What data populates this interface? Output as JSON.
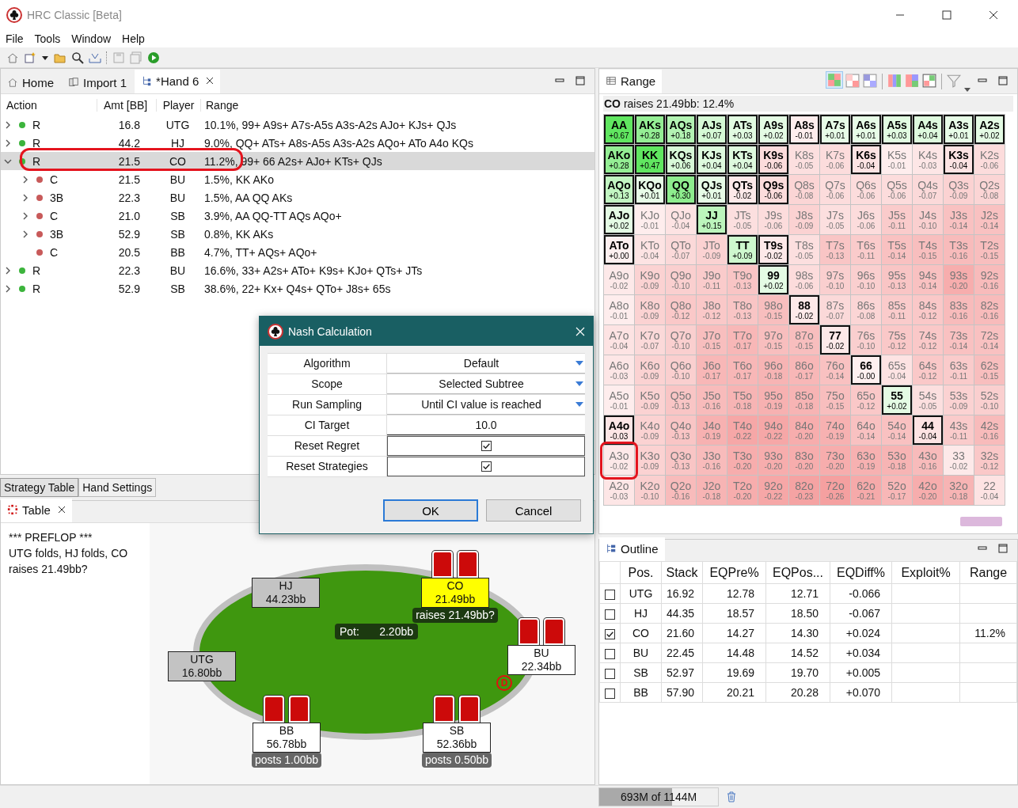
{
  "window": {
    "title": "HRC Classic [Beta]"
  },
  "menu": [
    "File",
    "Tools",
    "Window",
    "Help"
  ],
  "editor_tabs": [
    {
      "label": "Home",
      "kind": "home",
      "selected": false
    },
    {
      "label": "Import 1",
      "kind": "import",
      "selected": false
    },
    {
      "label": "*Hand 6",
      "kind": "tree",
      "selected": true
    }
  ],
  "tree": {
    "columns": [
      "Action",
      "Amt [BB]",
      "Player",
      "Range"
    ],
    "rows": [
      {
        "action": "R",
        "amt": "16.8",
        "player": "UTG",
        "range": "10.1%, 99+ A9s+ A7s-A5s A3s-A2s AJo+ KJs+ QJs",
        "color": "#3cb43c",
        "expandable": true,
        "expanded": false,
        "selected": false,
        "circled": false
      },
      {
        "action": "R",
        "amt": "44.2",
        "player": "HJ",
        "range": "9.0%, QQ+ ATs+ A8s-A5s A3s-A2s AQo+ ATo A4o KQs",
        "color": "#3cb43c",
        "expandable": true,
        "expanded": false,
        "selected": false,
        "circled": false
      },
      {
        "action": "R",
        "amt": "21.5",
        "player": "CO",
        "range": "11.2%, 99+ 66 A2s+ AJo+ KTs+ QJs",
        "color": "#3cb43c",
        "expandable": true,
        "expanded": true,
        "selected": true,
        "circled": true,
        "children": [
          {
            "action": "C",
            "amt": "21.5",
            "player": "BU",
            "range": "1.5%, KK AKo",
            "color": "#c85a5a",
            "expandable": true,
            "expanded": false,
            "selected": false,
            "circled": false
          },
          {
            "action": "3B",
            "amt": "22.3",
            "player": "BU",
            "range": "1.5%, AA QQ AKs",
            "color": "#c85a5a",
            "expandable": true,
            "expanded": false,
            "selected": false,
            "circled": false
          },
          {
            "action": "C",
            "amt": "21.0",
            "player": "SB",
            "range": "3.9%, AA QQ-TT AQs AQo+",
            "color": "#c85a5a",
            "expandable": true,
            "expanded": false,
            "selected": false,
            "circled": false
          },
          {
            "action": "3B",
            "amt": "52.9",
            "player": "SB",
            "range": "0.8%, KK AKs",
            "color": "#c85a5a",
            "expandable": true,
            "expanded": false,
            "selected": false,
            "circled": false
          },
          {
            "action": "C",
            "amt": "20.5",
            "player": "BB",
            "range": "4.7%, TT+ AQs+ AQo+",
            "color": "#c85a5a",
            "expandable": false,
            "selected": false,
            "circled": false
          }
        ]
      },
      {
        "action": "R",
        "amt": "22.3",
        "player": "BU",
        "range": "16.6%, 33+ A2s+ ATo+ K9s+ KJo+ QTs+ JTs",
        "color": "#3cb43c",
        "expandable": true,
        "expanded": false,
        "selected": false,
        "circled": false
      },
      {
        "action": "R",
        "amt": "52.9",
        "player": "SB",
        "range": "38.6%, 22+ Kx+ Q4s+ QTo+ J8s+ 65s",
        "color": "#3cb43c",
        "expandable": true,
        "expanded": false,
        "selected": false,
        "circled": false
      }
    ]
  },
  "bottom_tabs": [
    {
      "label": "Strategy Table",
      "selected": true
    },
    {
      "label": "Hand Settings",
      "selected": false
    }
  ],
  "table_view": {
    "tab": "Table",
    "history": [
      "*** PREFLOP ***",
      "UTG folds, HJ folds, CO raises 21.49bb?"
    ],
    "pot": {
      "label": "Pot:",
      "amount": "2.20bb"
    },
    "dealer": "D",
    "seats": [
      {
        "position": "HJ",
        "stack": "44.23bb",
        "folded": true,
        "acting": false,
        "has_cards": false,
        "dealer": false
      },
      {
        "position": "CO",
        "stack": "21.49bb",
        "folded": false,
        "acting": true,
        "has_cards": true,
        "action": "raises 21.49bb?",
        "pending": true,
        "dealer": false
      },
      {
        "position": "BU",
        "stack": "22.34bb",
        "folded": false,
        "acting": false,
        "has_cards": true,
        "dealer": true
      },
      {
        "position": "UTG",
        "stack": "16.80bb",
        "folded": true,
        "acting": false,
        "has_cards": false,
        "dealer": false
      },
      {
        "position": "BB",
        "stack": "56.78bb",
        "folded": false,
        "acting": false,
        "has_cards": true,
        "action": "posts 1.00bb",
        "pending": false,
        "dealer": false
      },
      {
        "position": "SB",
        "stack": "52.36bb",
        "folded": false,
        "acting": false,
        "has_cards": true,
        "action": "posts 0.50bb",
        "pending": false,
        "dealer": false
      }
    ]
  },
  "range": {
    "tab": "Range",
    "title": "**CO** raises 21.49bb: 12.4%",
    "grid": [
      [
        {
          "hand": "AA",
          "ev": "+0.67",
          "in_range": true,
          "circled": false
        },
        {
          "hand": "AKs",
          "ev": "+0.28",
          "in_range": true,
          "circled": false
        },
        {
          "hand": "AQs",
          "ev": "+0.18",
          "in_range": true,
          "circled": false
        },
        {
          "hand": "AJs",
          "ev": "+0.07",
          "in_range": true,
          "circled": false
        },
        {
          "hand": "ATs",
          "ev": "+0.03",
          "in_range": true,
          "circled": false
        },
        {
          "hand": "A9s",
          "ev": "+0.02",
          "in_range": true,
          "circled": false
        },
        {
          "hand": "A8s",
          "ev": "-0.01",
          "in_range": true,
          "circled": false
        },
        {
          "hand": "A7s",
          "ev": "+0.01",
          "in_range": true,
          "circled": false
        },
        {
          "hand": "A6s",
          "ev": "+0.01",
          "in_range": true,
          "circled": false
        },
        {
          "hand": "A5s",
          "ev": "+0.03",
          "in_range": true,
          "circled": false
        },
        {
          "hand": "A4s",
          "ev": "+0.04",
          "in_range": true,
          "circled": false
        },
        {
          "hand": "A3s",
          "ev": "+0.01",
          "in_range": true,
          "circled": false
        },
        {
          "hand": "A2s",
          "ev": "+0.02",
          "in_range": true,
          "circled": false
        }
      ],
      [
        {
          "hand": "AKo",
          "ev": "+0.28",
          "in_range": true,
          "circled": false
        },
        {
          "hand": "KK",
          "ev": "+0.47",
          "in_range": true,
          "circled": false
        },
        {
          "hand": "KQs",
          "ev": "+0.06",
          "in_range": true,
          "circled": false
        },
        {
          "hand": "KJs",
          "ev": "+0.04",
          "in_range": true,
          "circled": false
        },
        {
          "hand": "KTs",
          "ev": "+0.04",
          "in_range": true,
          "circled": false
        },
        {
          "hand": "K9s",
          "ev": "-0.06",
          "in_range": true,
          "circled": false
        },
        {
          "hand": "K8s",
          "ev": "-0.05",
          "in_range": false,
          "circled": false
        },
        {
          "hand": "K7s",
          "ev": "-0.06",
          "in_range": false,
          "circled": false
        },
        {
          "hand": "K6s",
          "ev": "-0.04",
          "in_range": true,
          "circled": false
        },
        {
          "hand": "K5s",
          "ev": "-0.01",
          "in_range": false,
          "circled": false
        },
        {
          "hand": "K4s",
          "ev": "-0.03",
          "in_range": false,
          "circled": false
        },
        {
          "hand": "K3s",
          "ev": "-0.04",
          "in_range": true,
          "circled": false
        },
        {
          "hand": "K2s",
          "ev": "-0.06",
          "in_range": false,
          "circled": false
        }
      ],
      [
        {
          "hand": "AQo",
          "ev": "+0.13",
          "in_range": true,
          "circled": false
        },
        {
          "hand": "KQo",
          "ev": "+0.01",
          "in_range": true,
          "circled": false
        },
        {
          "hand": "QQ",
          "ev": "+0.30",
          "in_range": true,
          "circled": false
        },
        {
          "hand": "QJs",
          "ev": "+0.01",
          "in_range": true,
          "circled": false
        },
        {
          "hand": "QTs",
          "ev": "-0.02",
          "in_range": true,
          "circled": false
        },
        {
          "hand": "Q9s",
          "ev": "-0.06",
          "in_range": true,
          "circled": false
        },
        {
          "hand": "Q8s",
          "ev": "-0.08",
          "in_range": false,
          "circled": false
        },
        {
          "hand": "Q7s",
          "ev": "-0.06",
          "in_range": false,
          "circled": false
        },
        {
          "hand": "Q6s",
          "ev": "-0.06",
          "in_range": false,
          "circled": false
        },
        {
          "hand": "Q5s",
          "ev": "-0.06",
          "in_range": false,
          "circled": false
        },
        {
          "hand": "Q4s",
          "ev": "-0.07",
          "in_range": false,
          "circled": false
        },
        {
          "hand": "Q3s",
          "ev": "-0.09",
          "in_range": false,
          "circled": false
        },
        {
          "hand": "Q2s",
          "ev": "-0.08",
          "in_range": false,
          "circled": false
        }
      ],
      [
        {
          "hand": "AJo",
          "ev": "+0.02",
          "in_range": true,
          "circled": false
        },
        {
          "hand": "KJo",
          "ev": "-0.01",
          "in_range": false,
          "circled": false
        },
        {
          "hand": "QJo",
          "ev": "-0.04",
          "in_range": false,
          "circled": false
        },
        {
          "hand": "JJ",
          "ev": "+0.15",
          "in_range": true,
          "circled": false
        },
        {
          "hand": "JTs",
          "ev": "-0.05",
          "in_range": false,
          "circled": false
        },
        {
          "hand": "J9s",
          "ev": "-0.06",
          "in_range": false,
          "circled": false
        },
        {
          "hand": "J8s",
          "ev": "-0.09",
          "in_range": false,
          "circled": false
        },
        {
          "hand": "J7s",
          "ev": "-0.05",
          "in_range": false,
          "circled": false
        },
        {
          "hand": "J6s",
          "ev": "-0.06",
          "in_range": false,
          "circled": false
        },
        {
          "hand": "J5s",
          "ev": "-0.11",
          "in_range": false,
          "circled": false
        },
        {
          "hand": "J4s",
          "ev": "-0.10",
          "in_range": false,
          "circled": false
        },
        {
          "hand": "J3s",
          "ev": "-0.14",
          "in_range": false,
          "circled": false
        },
        {
          "hand": "J2s",
          "ev": "-0.14",
          "in_range": false,
          "circled": false
        }
      ],
      [
        {
          "hand": "ATo",
          "ev": "+0.00",
          "in_range": true,
          "circled": false
        },
        {
          "hand": "KTo",
          "ev": "-0.04",
          "in_range": false,
          "circled": false
        },
        {
          "hand": "QTo",
          "ev": "-0.07",
          "in_range": false,
          "circled": false
        },
        {
          "hand": "JTo",
          "ev": "-0.09",
          "in_range": false,
          "circled": false
        },
        {
          "hand": "TT",
          "ev": "+0.09",
          "in_range": true,
          "circled": false
        },
        {
          "hand": "T9s",
          "ev": "-0.02",
          "in_range": true,
          "circled": false
        },
        {
          "hand": "T8s",
          "ev": "-0.05",
          "in_range": false,
          "circled": false
        },
        {
          "hand": "T7s",
          "ev": "-0.13",
          "in_range": false,
          "circled": false
        },
        {
          "hand": "T6s",
          "ev": "-0.11",
          "in_range": false,
          "circled": false
        },
        {
          "hand": "T5s",
          "ev": "-0.14",
          "in_range": false,
          "circled": false
        },
        {
          "hand": "T4s",
          "ev": "-0.15",
          "in_range": false,
          "circled": false
        },
        {
          "hand": "T3s",
          "ev": "-0.16",
          "in_range": false,
          "circled": false
        },
        {
          "hand": "T2s",
          "ev": "-0.15",
          "in_range": false,
          "circled": false
        }
      ],
      [
        {
          "hand": "A9o",
          "ev": "-0.02",
          "in_range": false,
          "circled": false
        },
        {
          "hand": "K9o",
          "ev": "-0.09",
          "in_range": false,
          "circled": false
        },
        {
          "hand": "Q9o",
          "ev": "-0.10",
          "in_range": false,
          "circled": false
        },
        {
          "hand": "J9o",
          "ev": "-0.11",
          "in_range": false,
          "circled": false
        },
        {
          "hand": "T9o",
          "ev": "-0.13",
          "in_range": false,
          "circled": false
        },
        {
          "hand": "99",
          "ev": "+0.02",
          "in_range": true,
          "circled": false
        },
        {
          "hand": "98s",
          "ev": "-0.06",
          "in_range": false,
          "circled": false
        },
        {
          "hand": "97s",
          "ev": "-0.10",
          "in_range": false,
          "circled": false
        },
        {
          "hand": "96s",
          "ev": "-0.10",
          "in_range": false,
          "circled": false
        },
        {
          "hand": "95s",
          "ev": "-0.13",
          "in_range": false,
          "circled": false
        },
        {
          "hand": "94s",
          "ev": "-0.14",
          "in_range": false,
          "circled": false
        },
        {
          "hand": "93s",
          "ev": "-0.20",
          "in_range": false,
          "circled": false
        },
        {
          "hand": "92s",
          "ev": "-0.16",
          "in_range": false,
          "circled": false
        }
      ],
      [
        {
          "hand": "A8o",
          "ev": "-0.01",
          "in_range": false,
          "circled": false
        },
        {
          "hand": "K8o",
          "ev": "-0.09",
          "in_range": false,
          "circled": false
        },
        {
          "hand": "Q8o",
          "ev": "-0.12",
          "in_range": false,
          "circled": false
        },
        {
          "hand": "J8o",
          "ev": "-0.12",
          "in_range": false,
          "circled": false
        },
        {
          "hand": "T8o",
          "ev": "-0.13",
          "in_range": false,
          "circled": false
        },
        {
          "hand": "98o",
          "ev": "-0.15",
          "in_range": false,
          "circled": false
        },
        {
          "hand": "88",
          "ev": "-0.02",
          "in_range": true,
          "circled": false
        },
        {
          "hand": "87s",
          "ev": "-0.07",
          "in_range": false,
          "circled": false
        },
        {
          "hand": "86s",
          "ev": "-0.08",
          "in_range": false,
          "circled": false
        },
        {
          "hand": "85s",
          "ev": "-0.11",
          "in_range": false,
          "circled": false
        },
        {
          "hand": "84s",
          "ev": "-0.12",
          "in_range": false,
          "circled": false
        },
        {
          "hand": "83s",
          "ev": "-0.16",
          "in_range": false,
          "circled": false
        },
        {
          "hand": "82s",
          "ev": "-0.16",
          "in_range": false,
          "circled": false
        }
      ],
      [
        {
          "hand": "A7o",
          "ev": "-0.04",
          "in_range": false,
          "circled": false
        },
        {
          "hand": "K7o",
          "ev": "-0.07",
          "in_range": false,
          "circled": false
        },
        {
          "hand": "Q7o",
          "ev": "-0.10",
          "in_range": false,
          "circled": false
        },
        {
          "hand": "J7o",
          "ev": "-0.15",
          "in_range": false,
          "circled": false
        },
        {
          "hand": "T7o",
          "ev": "-0.17",
          "in_range": false,
          "circled": false
        },
        {
          "hand": "97o",
          "ev": "-0.15",
          "in_range": false,
          "circled": false
        },
        {
          "hand": "87o",
          "ev": "-0.15",
          "in_range": false,
          "circled": false
        },
        {
          "hand": "77",
          "ev": "-0.02",
          "in_range": true,
          "circled": false
        },
        {
          "hand": "76s",
          "ev": "-0.10",
          "in_range": false,
          "circled": false
        },
        {
          "hand": "75s",
          "ev": "-0.12",
          "in_range": false,
          "circled": false
        },
        {
          "hand": "74s",
          "ev": "-0.12",
          "in_range": false,
          "circled": false
        },
        {
          "hand": "73s",
          "ev": "-0.14",
          "in_range": false,
          "circled": false
        },
        {
          "hand": "72s",
          "ev": "-0.14",
          "in_range": false,
          "circled": false
        }
      ],
      [
        {
          "hand": "A6o",
          "ev": "-0.03",
          "in_range": false,
          "circled": false
        },
        {
          "hand": "K6o",
          "ev": "-0.09",
          "in_range": false,
          "circled": false
        },
        {
          "hand": "Q6o",
          "ev": "-0.10",
          "in_range": false,
          "circled": false
        },
        {
          "hand": "J6o",
          "ev": "-0.17",
          "in_range": false,
          "circled": false
        },
        {
          "hand": "T6o",
          "ev": "-0.17",
          "in_range": false,
          "circled": false
        },
        {
          "hand": "96o",
          "ev": "-0.18",
          "in_range": false,
          "circled": false
        },
        {
          "hand": "86o",
          "ev": "-0.17",
          "in_range": false,
          "circled": false
        },
        {
          "hand": "76o",
          "ev": "-0.14",
          "in_range": false,
          "circled": false
        },
        {
          "hand": "66",
          "ev": "-0.00",
          "in_range": true,
          "circled": false
        },
        {
          "hand": "65s",
          "ev": "-0.04",
          "in_range": false,
          "circled": false
        },
        {
          "hand": "64s",
          "ev": "-0.12",
          "in_range": false,
          "circled": false
        },
        {
          "hand": "63s",
          "ev": "-0.11",
          "in_range": false,
          "circled": false
        },
        {
          "hand": "62s",
          "ev": "-0.15",
          "in_range": false,
          "circled": false
        }
      ],
      [
        {
          "hand": "A5o",
          "ev": "-0.01",
          "in_range": false,
          "circled": false
        },
        {
          "hand": "K5o",
          "ev": "-0.09",
          "in_range": false,
          "circled": false
        },
        {
          "hand": "Q5o",
          "ev": "-0.13",
          "in_range": false,
          "circled": false
        },
        {
          "hand": "J5o",
          "ev": "-0.16",
          "in_range": false,
          "circled": false
        },
        {
          "hand": "T5o",
          "ev": "-0.18",
          "in_range": false,
          "circled": false
        },
        {
          "hand": "95o",
          "ev": "-0.19",
          "in_range": false,
          "circled": false
        },
        {
          "hand": "85o",
          "ev": "-0.18",
          "in_range": false,
          "circled": false
        },
        {
          "hand": "75o",
          "ev": "-0.15",
          "in_range": false,
          "circled": false
        },
        {
          "hand": "65o",
          "ev": "-0.12",
          "in_range": false,
          "circled": false
        },
        {
          "hand": "55",
          "ev": "+0.02",
          "in_range": true,
          "circled": false
        },
        {
          "hand": "54s",
          "ev": "-0.05",
          "in_range": false,
          "circled": false
        },
        {
          "hand": "53s",
          "ev": "-0.09",
          "in_range": false,
          "circled": false
        },
        {
          "hand": "52s",
          "ev": "-0.10",
          "in_range": false,
          "circled": false
        }
      ],
      [
        {
          "hand": "A4o",
          "ev": "-0.03",
          "in_range": true,
          "circled": false
        },
        {
          "hand": "K4o",
          "ev": "-0.09",
          "in_range": false,
          "circled": false
        },
        {
          "hand": "Q4o",
          "ev": "-0.13",
          "in_range": false,
          "circled": false
        },
        {
          "hand": "J4o",
          "ev": "-0.19",
          "in_range": false,
          "circled": false
        },
        {
          "hand": "T4o",
          "ev": "-0.22",
          "in_range": false,
          "circled": false
        },
        {
          "hand": "94o",
          "ev": "-0.22",
          "in_range": false,
          "circled": false
        },
        {
          "hand": "84o",
          "ev": "-0.20",
          "in_range": false,
          "circled": false
        },
        {
          "hand": "74o",
          "ev": "-0.19",
          "in_range": false,
          "circled": false
        },
        {
          "hand": "64o",
          "ev": "-0.14",
          "in_range": false,
          "circled": false
        },
        {
          "hand": "54o",
          "ev": "-0.14",
          "in_range": false,
          "circled": false
        },
        {
          "hand": "44",
          "ev": "-0.04",
          "in_range": true,
          "circled": false
        },
        {
          "hand": "43s",
          "ev": "-0.11",
          "in_range": false,
          "circled": false
        },
        {
          "hand": "42s",
          "ev": "-0.16",
          "in_range": false,
          "circled": false
        }
      ],
      [
        {
          "hand": "A3o",
          "ev": "-0.02",
          "in_range": false,
          "circled": true
        },
        {
          "hand": "K3o",
          "ev": "-0.09",
          "in_range": false,
          "circled": false
        },
        {
          "hand": "Q3o",
          "ev": "-0.13",
          "in_range": false,
          "circled": false
        },
        {
          "hand": "J3o",
          "ev": "-0.16",
          "in_range": false,
          "circled": false
        },
        {
          "hand": "T3o",
          "ev": "-0.20",
          "in_range": false,
          "circled": false
        },
        {
          "hand": "93o",
          "ev": "-0.20",
          "in_range": false,
          "circled": false
        },
        {
          "hand": "83o",
          "ev": "-0.20",
          "in_range": false,
          "circled": false
        },
        {
          "hand": "73o",
          "ev": "-0.20",
          "in_range": false,
          "circled": false
        },
        {
          "hand": "63o",
          "ev": "-0.19",
          "in_range": false,
          "circled": false
        },
        {
          "hand": "53o",
          "ev": "-0.18",
          "in_range": false,
          "circled": false
        },
        {
          "hand": "43o",
          "ev": "-0.16",
          "in_range": false,
          "circled": false
        },
        {
          "hand": "33",
          "ev": "-0.02",
          "in_range": false,
          "circled": false
        },
        {
          "hand": "32s",
          "ev": "-0.12",
          "in_range": false,
          "circled": false
        }
      ],
      [
        {
          "hand": "A2o",
          "ev": "-0.03",
          "in_range": false,
          "circled": false
        },
        {
          "hand": "K2o",
          "ev": "-0.10",
          "in_range": false,
          "circled": false
        },
        {
          "hand": "Q2o",
          "ev": "-0.16",
          "in_range": false,
          "circled": false
        },
        {
          "hand": "J2o",
          "ev": "-0.18",
          "in_range": false,
          "circled": false
        },
        {
          "hand": "T2o",
          "ev": "-0.20",
          "in_range": false,
          "circled": false
        },
        {
          "hand": "92o",
          "ev": "-0.22",
          "in_range": false,
          "circled": false
        },
        {
          "hand": "82o",
          "ev": "-0.23",
          "in_range": false,
          "circled": false
        },
        {
          "hand": "72o",
          "ev": "-0.26",
          "in_range": false,
          "circled": false
        },
        {
          "hand": "62o",
          "ev": "-0.21",
          "in_range": false,
          "circled": false
        },
        {
          "hand": "52o",
          "ev": "-0.17",
          "in_range": false,
          "circled": false
        },
        {
          "hand": "42o",
          "ev": "-0.20",
          "in_range": false,
          "circled": false
        },
        {
          "hand": "32o",
          "ev": "-0.18",
          "in_range": false,
          "circled": false
        },
        {
          "hand": "22",
          "ev": "-0.04",
          "in_range": false,
          "circled": false
        }
      ]
    ]
  },
  "outline": {
    "tab": "Outline",
    "columns": [
      "Pos.",
      "Stack",
      "EQPre%",
      "EQPos...",
      "EQDiff%",
      "Exploit%",
      "Range"
    ],
    "rows": [
      {
        "checked": false,
        "pos": "UTG",
        "stack": "16.92",
        "eq_pre": "12.78",
        "eq_post": "12.71",
        "eq_diff": "-0.066"
      },
      {
        "checked": false,
        "pos": "HJ",
        "stack": "44.35",
        "eq_pre": "18.57",
        "eq_post": "18.50",
        "eq_diff": "-0.067"
      },
      {
        "checked": true,
        "pos": "CO",
        "stack": "21.60",
        "eq_pre": "14.27",
        "eq_post": "14.30",
        "eq_diff": "+0.024",
        "range": "11.2%"
      },
      {
        "checked": false,
        "pos": "BU",
        "stack": "22.45",
        "eq_pre": "14.48",
        "eq_post": "14.52",
        "eq_diff": "+0.034"
      },
      {
        "checked": false,
        "pos": "SB",
        "stack": "52.97",
        "eq_pre": "19.69",
        "eq_post": "19.70",
        "eq_diff": "+0.005"
      },
      {
        "checked": false,
        "pos": "BB",
        "stack": "57.90",
        "eq_pre": "20.21",
        "eq_post": "20.28",
        "eq_diff": "+0.070"
      }
    ]
  },
  "dialog": {
    "title": "Nash Calculation",
    "fields": [
      {
        "label": "Algorithm",
        "kind": "dropdown",
        "value": "Default"
      },
      {
        "label": "Scope",
        "kind": "dropdown",
        "value": "Selected Subtree"
      },
      {
        "label": "Run Sampling",
        "kind": "dropdown",
        "value": "Until CI value is reached"
      },
      {
        "label": "CI Target",
        "kind": "text",
        "value": "10.0"
      },
      {
        "label": "Reset Regret",
        "kind": "checkbox",
        "checked": true
      },
      {
        "label": "Reset Strategies",
        "kind": "checkbox",
        "checked": true
      }
    ],
    "buttons": [
      {
        "label": "OK",
        "default": true
      },
      {
        "label": "Cancel",
        "default": false
      }
    ]
  },
  "status_bar": {
    "memory": "693M of 1144M",
    "level": 0.61
  }
}
